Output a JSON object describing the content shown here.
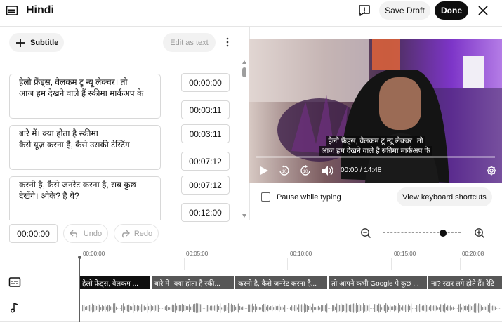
{
  "header": {
    "title": "Hindi",
    "save_draft": "Save Draft",
    "done": "Done"
  },
  "left_toolbar": {
    "add_subtitle": "Subtitle",
    "edit_as_text": "Edit as text"
  },
  "cues": [
    {
      "line1": "हेलो फ्रेंड्स, वेलकम टू न्यू लेक्चर। तो",
      "line2": "आज हम देखने वाले हैं स्कीमा मार्कअप के",
      "start": "00:00:00",
      "end": "00:03:11"
    },
    {
      "line1": "बारे में। क्या होता है स्कीमा",
      "line2": "कैसे यूज़ करना है, कैसे उसकी टेस्टिंग",
      "start": "00:03:11",
      "end": "00:07:12"
    },
    {
      "line1": "करनी है, कैसे जनरेट करना है, सब कुछ",
      "line2": "देखेंगे। ओके? है ये?",
      "start": "00:07:12",
      "end": "00:12:00"
    }
  ],
  "player": {
    "caption_line1": "हेलो फ्रेंड्स, वेलकम टू न्यू लेक्चर। तो",
    "caption_line2": "आज हम देखने वाले हैं स्कीमा मार्कअप के",
    "time": "00:00 / 14:48",
    "progress": 0.0
  },
  "below_player": {
    "pause_while_typing": "Pause while typing",
    "pause_checked": false,
    "keyboard_shortcuts": "View keyboard shortcuts"
  },
  "timeline": {
    "current_time": "00:00:00",
    "undo": "Undo",
    "redo": "Redo",
    "zoom_level": 0.77,
    "ruler": [
      "00:00:00",
      "00:05:00",
      "00:10:00",
      "00:15:00",
      "00:20:08"
    ],
    "segments": [
      "हेलो फ्रेंड्स, वेलकम ...",
      "बारे में। क्या होता है स्की...",
      "करनी है, कैसे जनरेट करना है...",
      "तो आपने कभी Google पे कुछ ...",
      "ना? स्टार लगे होते हैं। रेटि"
    ]
  }
}
